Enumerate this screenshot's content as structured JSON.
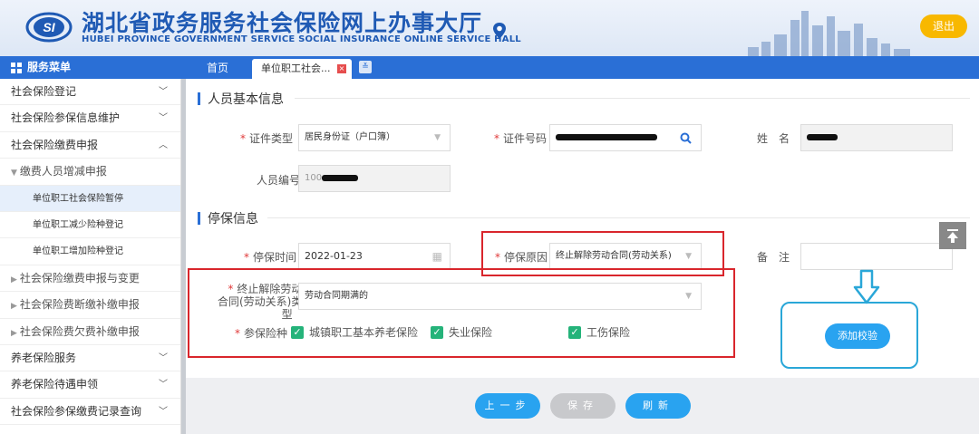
{
  "header": {
    "title_cn": "湖北省政务服务社会保险网上办事大厅",
    "title_en": "HUBEI PROVINCE GOVERNMENT SERVICE SOCIAL INSURANCE ONLINE SERVICE HALL",
    "logout_label": "退出",
    "logo_text": "SI"
  },
  "menu": {
    "title": "服务菜单"
  },
  "tabs": [
    {
      "label": "首页"
    },
    {
      "label": "单位职工社会..."
    }
  ],
  "sidebar": {
    "items": [
      {
        "label": "社会保险登记",
        "chevron": "﹀"
      },
      {
        "label": "社会保险参保信息维护",
        "chevron": "﹀"
      },
      {
        "label": "社会保险缴费申报",
        "chevron": "︿"
      }
    ],
    "sub_open": "缴费人员增减申报",
    "leaves": [
      {
        "label": "单位职工社会保险暂停"
      },
      {
        "label": "单位职工减少险种登记"
      },
      {
        "label": "单位职工增加险种登记"
      }
    ],
    "subs": [
      {
        "label": "社会保险缴费申报与变更"
      },
      {
        "label": "社会保险费断缴补缴申报"
      },
      {
        "label": "社会保险费欠费补缴申报"
      }
    ],
    "bottom": [
      {
        "label": "养老保险服务",
        "chevron": "﹀"
      },
      {
        "label": "养老保险待遇申领",
        "chevron": "﹀"
      },
      {
        "label": "社会保险参保缴费记录查询",
        "chevron": "﹀"
      }
    ]
  },
  "section_basic": {
    "title": "人员基本信息",
    "id_type_label": "证件类型",
    "id_type_value": "居民身份证（户口簿）",
    "id_number_label": "证件号码",
    "name_label": "姓　名",
    "person_no_label": "人员编号",
    "person_no_prefix": "100"
  },
  "section_stop": {
    "title": "停保信息",
    "stop_time_label": "停保时间",
    "stop_time_value": "2022-01-23",
    "stop_reason_label": "停保原因",
    "stop_reason_value": "终止解除劳动合同(劳动关系)",
    "remark_label": "备　注",
    "contract_type_label_1": "终止解除劳动",
    "contract_type_label_2": "合同(劳动关系)类",
    "contract_type_label_3": "型",
    "contract_type_value": "劳动合同期满的",
    "insurance_label": "参保险种",
    "insurances": [
      {
        "label": "城镇职工基本养老保险",
        "checked": true
      },
      {
        "label": "失业保险",
        "checked": true
      },
      {
        "label": "工伤保险",
        "checked": true
      }
    ]
  },
  "actions": {
    "add_check": "添加校验",
    "prev": "上一步",
    "save": "保存",
    "refresh": "刷新"
  },
  "colors": {
    "primary": "#2a6fd6",
    "button_blue": "#29a3f0",
    "annotation_red": "#d9262c",
    "annotation_blue": "#2aa7d8",
    "check_green": "#25b37a"
  }
}
